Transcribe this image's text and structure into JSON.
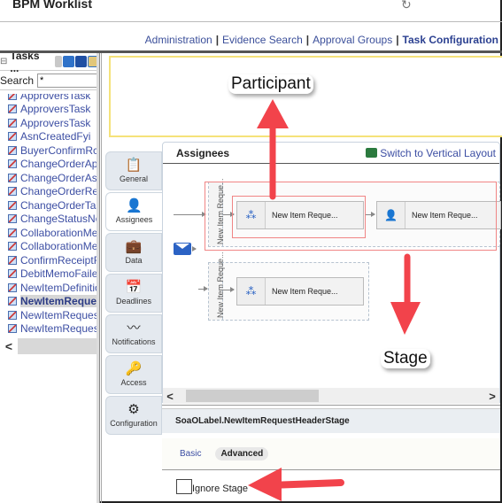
{
  "app": {
    "title": "BPM Worklist",
    "refresh_icon": "refresh-icon"
  },
  "nav": {
    "links": [
      {
        "label": "Administration",
        "active": false
      },
      {
        "label": "Evidence Search",
        "active": false
      },
      {
        "label": "Approval Groups",
        "active": false
      },
      {
        "label": "Task Configuration",
        "active": true
      }
    ],
    "separator": "|"
  },
  "left_panel": {
    "title": "Tasks ...",
    "search_label": "Search",
    "search_value": "*",
    "tasks": [
      "ApproversTask",
      "ApproversTask",
      "ApproversTask",
      "AsnCreatedFyi",
      "BuyerConfirmRcpt",
      "ChangeOrderAppr",
      "ChangeOrderAssi",
      "ChangeOrderReq",
      "ChangeOrderTask",
      "ChangeStatusNot",
      "CollaborationMess",
      "CollaborationMess",
      "ConfirmReceiptRe",
      "DebitMemoFailedI",
      "NewItemDefinition",
      "NewItemRequest",
      "NewItemRequest",
      "NewItemRequest"
    ],
    "selected_index": 15,
    "scroll_left": "<"
  },
  "side_tabs": [
    {
      "label": "General",
      "icon": "clipboard-check-icon",
      "glyph": "📋",
      "active": false
    },
    {
      "label": "Assignees",
      "icon": "person-icon",
      "glyph": "👤",
      "active": true
    },
    {
      "label": "Data",
      "icon": "briefcase-icon",
      "glyph": "💼",
      "active": false
    },
    {
      "label": "Deadlines",
      "icon": "calendar-icon",
      "glyph": "📅",
      "active": false
    },
    {
      "label": "Notifications",
      "icon": "rss-icon",
      "glyph": "〰",
      "active": false
    },
    {
      "label": "Access",
      "icon": "keys-icon",
      "glyph": "🔑",
      "active": false
    },
    {
      "label": "Configuration",
      "icon": "gear-icon",
      "glyph": "⚙",
      "active": false
    }
  ],
  "assignees": {
    "title": "Assignees",
    "switch_label": "Switch to Vertical Layout",
    "stages": [
      {
        "label": "New Item Reque...",
        "participants": [
          {
            "label": "New Item Reque...",
            "icon": "group-icon",
            "glyph": "⁂"
          },
          {
            "label": "New Item Reque...",
            "icon": "user-icon",
            "glyph": "👤"
          }
        ]
      },
      {
        "label": "New Item Reque...",
        "participants": [
          {
            "label": "New Item Reque...",
            "icon": "group-icon",
            "glyph": "⁂"
          }
        ]
      }
    ],
    "scroll_left": "<",
    "scroll_right": ">"
  },
  "properties": {
    "title": "SoaOLabel.NewItemRequestHeaderStage",
    "tabs": [
      {
        "label": "Basic",
        "active": false
      },
      {
        "label": "Advanced",
        "active": true
      }
    ],
    "ignore_stage_label": "Ignore Stage",
    "ignore_stage_checked": false
  },
  "annotations": {
    "participant": "Participant",
    "stage": "Stage",
    "arrow_color": "#f2434b"
  }
}
